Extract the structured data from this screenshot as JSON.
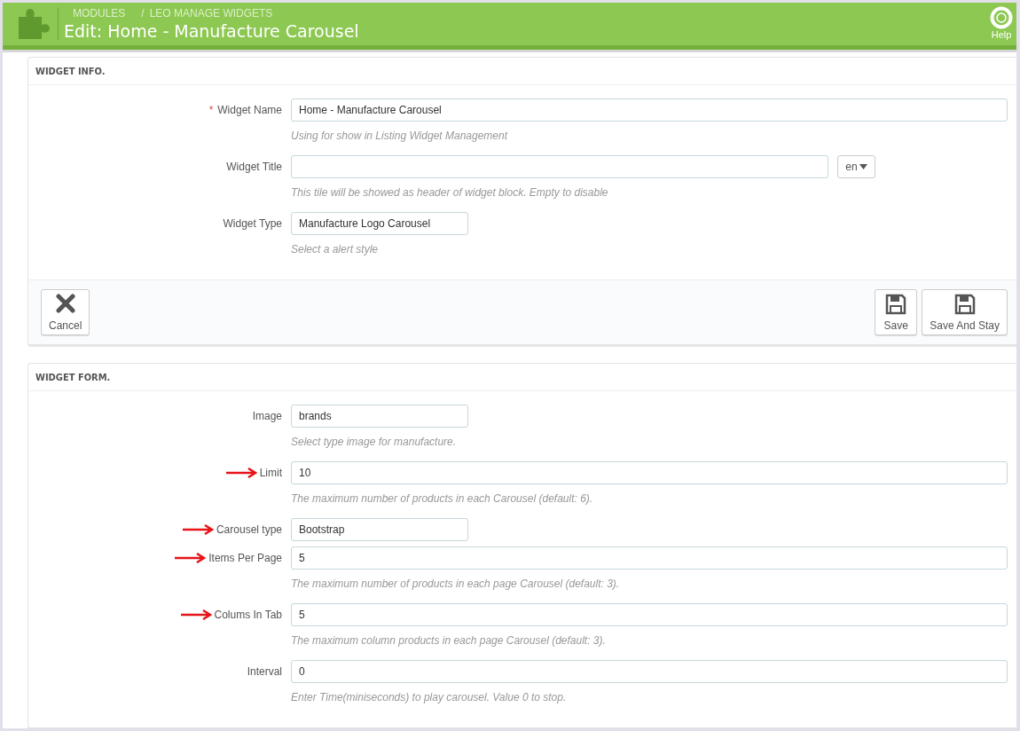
{
  "header": {
    "breadcrumb": [
      "MODULES",
      "LEO MANAGE WIDGETS"
    ],
    "breadcrumb_separator": "/",
    "title": "Edit: Home - Manufacture Carousel",
    "help_label": "Help"
  },
  "panels": [
    {
      "title": "WIDGET INFO.",
      "fields": [
        {
          "kind": "full",
          "label": "Widget Name",
          "required_mark": "*",
          "value": "Home - Manufacture Carousel",
          "help": "Using for show in Listing Widget Management",
          "arrow": false
        },
        {
          "kind": "lang",
          "label": "Widget Title",
          "language": "en",
          "help": "This tile will be showed as header of widget block. Empty to disable",
          "arrow": false
        },
        {
          "kind": "short",
          "label": "Widget Type",
          "value": "Manufacture Logo Carousel",
          "help": "Select a alert style",
          "arrow": false
        }
      ],
      "footer": {
        "cancel": "Cancel",
        "save": "Save",
        "save_stay": "Save And Stay"
      }
    },
    {
      "title": "WIDGET FORM.",
      "fields": [
        {
          "kind": "short",
          "label": "Image",
          "value": "brands",
          "help": "Select type image for manufacture.",
          "arrow": false
        },
        {
          "kind": "full",
          "label": "Limit",
          "value": "10",
          "help": "The maximum number of products in each Carousel (default: 6).",
          "arrow": true
        },
        {
          "kind": "short",
          "label": "Carousel type",
          "value": "Bootstrap",
          "arrow": true
        },
        {
          "kind": "full",
          "label": "Items Per Page",
          "value": "5",
          "help": "The maximum number of products in each page Carousel (default: 3).",
          "arrow": true
        },
        {
          "kind": "full",
          "label": "Colums In Tab",
          "value": "5",
          "help": "The maximum column products in each page Carousel (default: 3).",
          "arrow": true
        },
        {
          "kind": "full",
          "label": "Interval",
          "value": "0",
          "help": "Enter Time(miniseconds) to play carousel. Value 0 to stop.",
          "arrow": false
        }
      ]
    }
  ]
}
